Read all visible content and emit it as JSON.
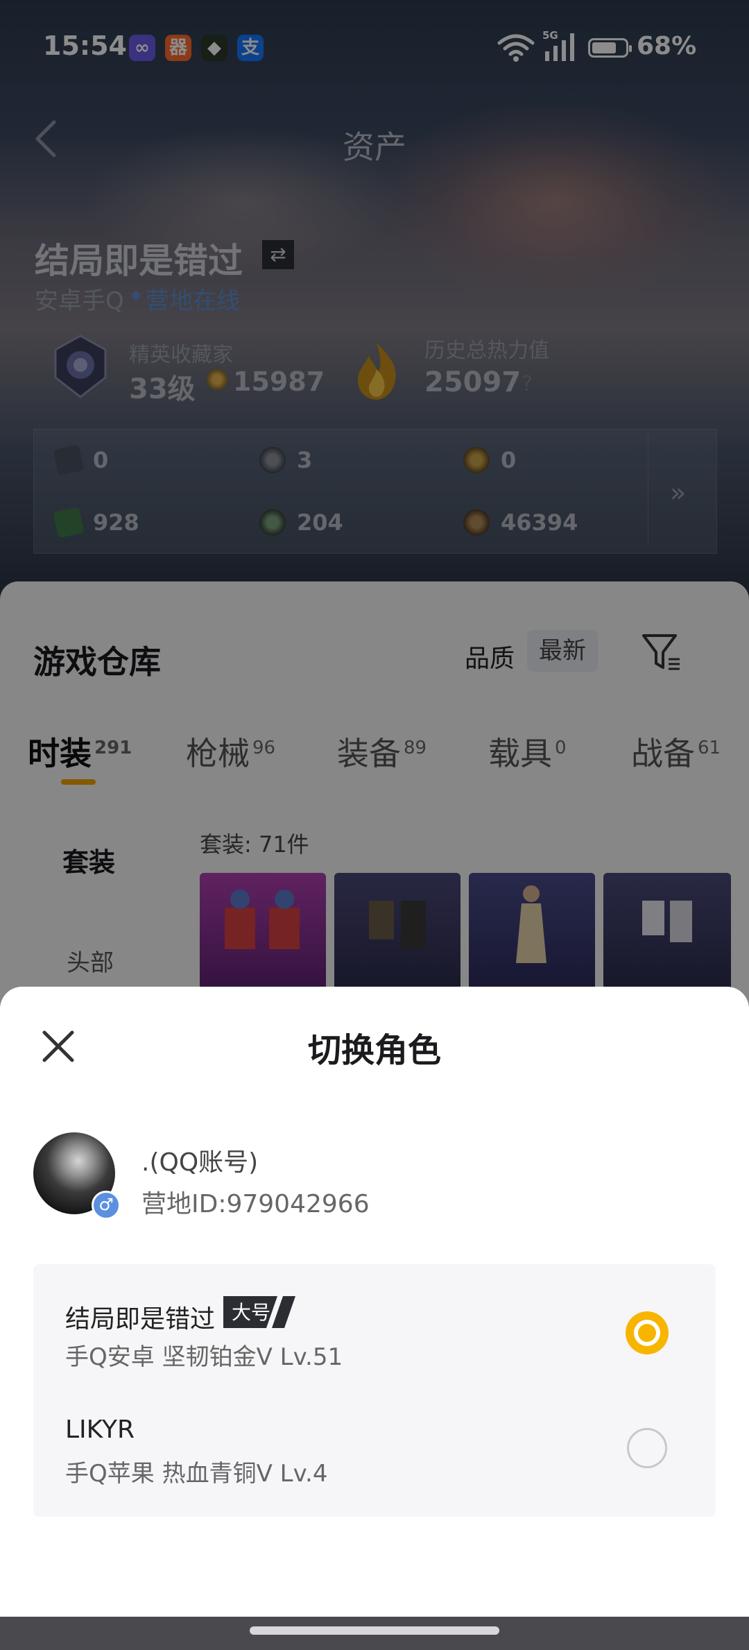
{
  "status": {
    "time": "15:54",
    "network": "5G",
    "battery": "68%",
    "app_icons": [
      "link-app-icon",
      "grid-app-icon",
      "cube-app-icon",
      "alipay-icon"
    ],
    "app_glyphs": [
      "∞",
      "器",
      "◆",
      "支"
    ]
  },
  "header": {
    "title": "资产"
  },
  "player": {
    "name": "结局即是错过",
    "swap_glyph": "⇄",
    "platform": "安卓手Q",
    "online": "营地在线",
    "collector_label": "精英收藏家",
    "collector_level": "33级",
    "collector_coins": "15987",
    "heat_label": "历史总热力值",
    "heat_value": "25097",
    "help": "?"
  },
  "currencies": [
    "0",
    "3",
    "0",
    "928",
    "204",
    "46394"
  ],
  "currency_more": "»",
  "warehouse": {
    "title": "游戏仓库",
    "sort_quality": "品质",
    "sort_newest": "最新",
    "tabs": [
      {
        "label": "时装",
        "count": "291"
      },
      {
        "label": "枪械",
        "count": "96"
      },
      {
        "label": "装备",
        "count": "89"
      },
      {
        "label": "载具",
        "count": "0"
      },
      {
        "label": "战备",
        "count": "61"
      }
    ],
    "side_active": "套装",
    "side_item": "头部",
    "suit_count": "套装: 71件"
  },
  "sheet": {
    "title": "切换角色",
    "account_name": ".(QQ账号)",
    "camp_id": "营地ID:979042966",
    "gender": "♂",
    "main_badge": "大号",
    "roles": [
      {
        "name": "结局即是错过",
        "info": "手Q安卓  坚韧铂金V  Lv.51",
        "selected": true
      },
      {
        "name": "LIKYR",
        "info": "手Q苹果  热血青铜V  Lv.4",
        "selected": false
      }
    ]
  },
  "colors": {
    "accent": "#f7b500",
    "online": "#5d8fce",
    "tab_underline": "#f0a200"
  }
}
